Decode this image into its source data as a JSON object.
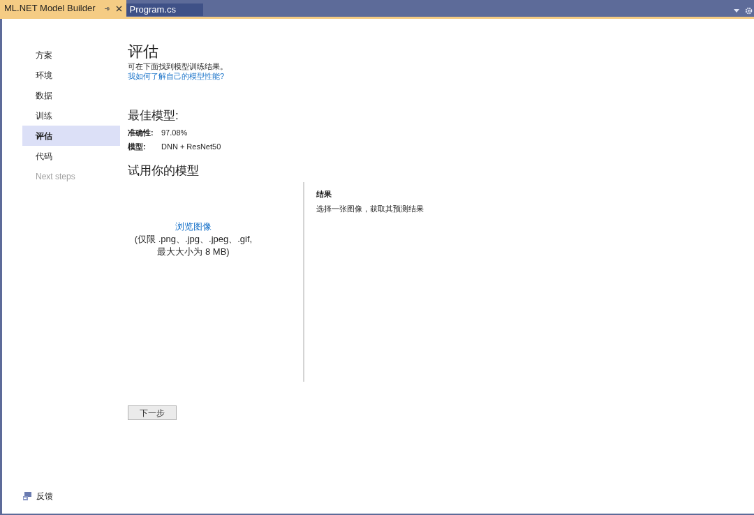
{
  "tabs": [
    {
      "label": "ML.NET Model Builder",
      "selected": true
    },
    {
      "label": "Program.cs",
      "selected": false
    }
  ],
  "nav": [
    {
      "label": "方案",
      "selected": false,
      "disabled": false
    },
    {
      "label": "环境",
      "selected": false,
      "disabled": false
    },
    {
      "label": "数据",
      "selected": false,
      "disabled": false
    },
    {
      "label": "训练",
      "selected": false,
      "disabled": false
    },
    {
      "label": "评估",
      "selected": true,
      "disabled": false
    },
    {
      "label": "代码",
      "selected": false,
      "disabled": false
    },
    {
      "label": "Next steps",
      "selected": false,
      "disabled": true
    }
  ],
  "page": {
    "title": "评估",
    "subtitle": "可在下面找到模型训练结果。",
    "help_link": "我如何了解自己的模型性能?"
  },
  "best_model": {
    "heading": "最佳模型:",
    "fields": [
      {
        "label": "准确性:",
        "value": "97.08%"
      },
      {
        "label": "模型:",
        "value": "DNN + ResNet50"
      }
    ]
  },
  "try_model": {
    "heading": "试用你的模型",
    "browse_link": "浏览图像",
    "file_hint_lines": [
      "(仅限 .png、.jpg、.jpeg、.gif,",
      "最大大小为 8 MB)"
    ],
    "results_heading": "结果",
    "results_text": "选择一张图像，获取其预测结果"
  },
  "next_button": "下一步",
  "feedback": "反馈"
}
